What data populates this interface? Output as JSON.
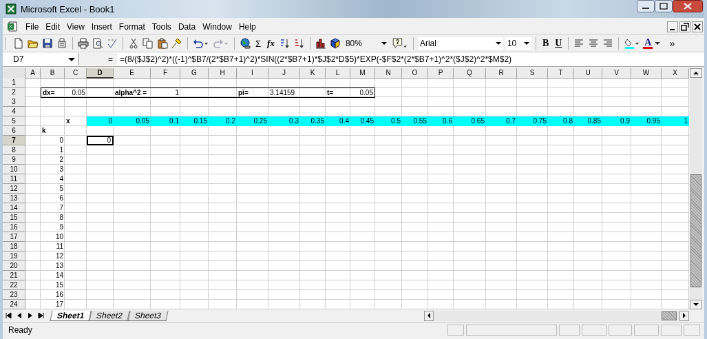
{
  "window": {
    "title": "Microsoft Excel - Book1"
  },
  "menu": [
    {
      "label": "File"
    },
    {
      "label": "Edit"
    },
    {
      "label": "View"
    },
    {
      "label": "Insert"
    },
    {
      "label": "Format"
    },
    {
      "label": "Tools"
    },
    {
      "label": "Data"
    },
    {
      "label": "Window"
    },
    {
      "label": "Help"
    }
  ],
  "toolbar": {
    "sum": "Σ",
    "function": "fx",
    "zoom": "80%",
    "font": "Arial",
    "size": "10",
    "bold": "B",
    "underline": "U",
    "font_color": "A",
    "more": "»"
  },
  "name_box": "D7",
  "formula_equals": "=",
  "formula": "=(8/($J$2)^2)*((-1)^$B7/(2*$B7+1)^2)*SIN((2*$B7+1)*$J$2*D$5)*EXP(-$F$2*(2*$B7+1)^2*($J$2)^2*$M$2)",
  "columns": [
    {
      "label": "A",
      "selected": false
    },
    {
      "label": "B",
      "selected": false
    },
    {
      "label": "C",
      "selected": false
    },
    {
      "label": "D",
      "selected": true
    },
    {
      "label": "E",
      "selected": false
    },
    {
      "label": "F",
      "selected": false
    },
    {
      "label": "G",
      "selected": false
    },
    {
      "label": "H",
      "selected": false
    },
    {
      "label": "I",
      "selected": false
    },
    {
      "label": "J",
      "selected": false
    },
    {
      "label": "K",
      "selected": false
    },
    {
      "label": "L",
      "selected": false
    },
    {
      "label": "M",
      "selected": false
    },
    {
      "label": "N",
      "selected": false
    },
    {
      "label": "O",
      "selected": false
    },
    {
      "label": "P",
      "selected": false
    },
    {
      "label": "Q",
      "selected": false
    },
    {
      "label": "R",
      "selected": false
    },
    {
      "label": "S",
      "selected": false
    },
    {
      "label": "T",
      "selected": false
    },
    {
      "label": "U",
      "selected": false
    },
    {
      "label": "V",
      "selected": false
    },
    {
      "label": "W",
      "selected": false
    },
    {
      "label": "X",
      "selected": false
    }
  ],
  "rows": [
    {
      "n": "1",
      "selected": false
    },
    {
      "n": "2",
      "selected": false,
      "outlined": true,
      "cells": {
        "B": {
          "text": "dx=",
          "bold": true
        },
        "C": {
          "text": "0.05"
        },
        "E": {
          "text": "alpha^2 =",
          "bold": true
        },
        "F": {
          "text": "1"
        },
        "I": {
          "text": "pi=",
          "bold": true
        },
        "J": {
          "text": "3.14159",
          "left": true
        },
        "L": {
          "text": "t=",
          "bold": true
        },
        "M": {
          "text": "0.05"
        }
      }
    },
    {
      "n": "3",
      "selected": false
    },
    {
      "n": "4",
      "selected": false
    },
    {
      "n": "5",
      "selected": false,
      "cells": {
        "C": {
          "text": "x",
          "bold": true
        },
        "D": {
          "text": "0",
          "fill": true
        },
        "E": {
          "text": "0.05",
          "fill": true
        },
        "F": {
          "text": "0.1",
          "fill": true
        },
        "G": {
          "text": "0.15",
          "fill": true
        },
        "H": {
          "text": "0.2",
          "fill": true
        },
        "I": {
          "text": "0.25",
          "fill": true
        },
        "J": {
          "text": "0.3",
          "fill": true
        },
        "K": {
          "text": "0.35",
          "fill": true
        },
        "L": {
          "text": "0.4",
          "fill": true
        },
        "M": {
          "text": "0.45",
          "fill": true
        },
        "N": {
          "text": "0.5",
          "fill": true
        },
        "O": {
          "text": "0.55",
          "fill": true
        },
        "P": {
          "text": "0.6",
          "fill": true
        },
        "Q": {
          "text": "0.65",
          "fill": true
        },
        "R": {
          "text": "0.7",
          "fill": true
        },
        "S": {
          "text": "0.75",
          "fill": true
        },
        "T": {
          "text": "0.8",
          "fill": true
        },
        "U": {
          "text": "0.85",
          "fill": true
        },
        "V": {
          "text": "0.9",
          "fill": true
        },
        "W": {
          "text": "0.95",
          "fill": true
        },
        "X": {
          "text": "1",
          "fill": true
        }
      }
    },
    {
      "n": "6",
      "selected": false,
      "cells": {
        "B": {
          "text": "k",
          "bold": true
        }
      }
    },
    {
      "n": "7",
      "selected": true,
      "cells": {
        "B": {
          "text": "0"
        },
        "D": {
          "text": "0",
          "selected": true
        }
      }
    },
    {
      "n": "8",
      "selected": false,
      "cells": {
        "B": {
          "text": "1"
        }
      }
    },
    {
      "n": "9",
      "selected": false,
      "cells": {
        "B": {
          "text": "2"
        }
      }
    },
    {
      "n": "10",
      "selected": false,
      "cells": {
        "B": {
          "text": "3"
        }
      }
    },
    {
      "n": "11",
      "selected": false,
      "cells": {
        "B": {
          "text": "4"
        }
      }
    },
    {
      "n": "12",
      "selected": false,
      "cells": {
        "B": {
          "text": "5"
        }
      }
    },
    {
      "n": "13",
      "selected": false,
      "cells": {
        "B": {
          "text": "6"
        }
      }
    },
    {
      "n": "14",
      "selected": false,
      "cells": {
        "B": {
          "text": "7"
        }
      }
    },
    {
      "n": "15",
      "selected": false,
      "cells": {
        "B": {
          "text": "8"
        }
      }
    },
    {
      "n": "16",
      "selected": false,
      "cells": {
        "B": {
          "text": "9"
        }
      }
    },
    {
      "n": "17",
      "selected": false,
      "cells": {
        "B": {
          "text": "10"
        }
      }
    },
    {
      "n": "18",
      "selected": false,
      "cells": {
        "B": {
          "text": "11"
        }
      }
    },
    {
      "n": "19",
      "selected": false,
      "cells": {
        "B": {
          "text": "12"
        }
      }
    },
    {
      "n": "20",
      "selected": false,
      "cells": {
        "B": {
          "text": "13"
        }
      }
    },
    {
      "n": "21",
      "selected": false,
      "cells": {
        "B": {
          "text": "14"
        }
      }
    },
    {
      "n": "22",
      "selected": false,
      "cells": {
        "B": {
          "text": "15"
        }
      }
    },
    {
      "n": "23",
      "selected": false,
      "cells": {
        "B": {
          "text": "16"
        }
      }
    },
    {
      "n": "24",
      "selected": false,
      "cells": {
        "B": {
          "text": "17"
        }
      }
    }
  ],
  "sheets": [
    {
      "label": "Sheet1",
      "selected": true
    },
    {
      "label": "Sheet2",
      "selected": false
    },
    {
      "label": "Sheet3",
      "selected": false
    }
  ],
  "status": "Ready"
}
